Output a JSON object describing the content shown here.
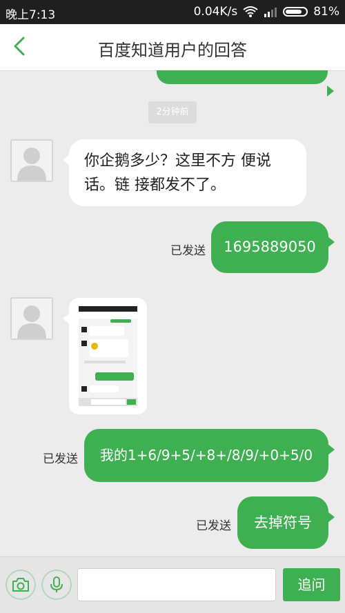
{
  "status_bar": {
    "time": "晚上7:13",
    "network_speed": "0.04K/s",
    "battery_percent": "81%",
    "battery_level": 0.81
  },
  "header": {
    "title": "百度知道用户的回答"
  },
  "chat": {
    "timestamp": "2分钟前",
    "messages": [
      {
        "side": "left",
        "text": "你企鹅多少？这里不方 便说话。链 接都发不了。"
      },
      {
        "side": "right",
        "text": "1695889050",
        "status": "已发送"
      },
      {
        "side": "left",
        "type": "image"
      },
      {
        "side": "right",
        "text": "我的1+6/9+5/+8+/8/9/+0+5/0",
        "status": "已发送"
      },
      {
        "side": "right",
        "text": "去掉符号",
        "status": "已发送"
      }
    ]
  },
  "input_bar": {
    "camera_icon": "camera-icon",
    "mic_icon": "microphone-icon",
    "ask_label": "追问"
  },
  "colors": {
    "accent": "#3fb051",
    "background": "#ececec"
  }
}
